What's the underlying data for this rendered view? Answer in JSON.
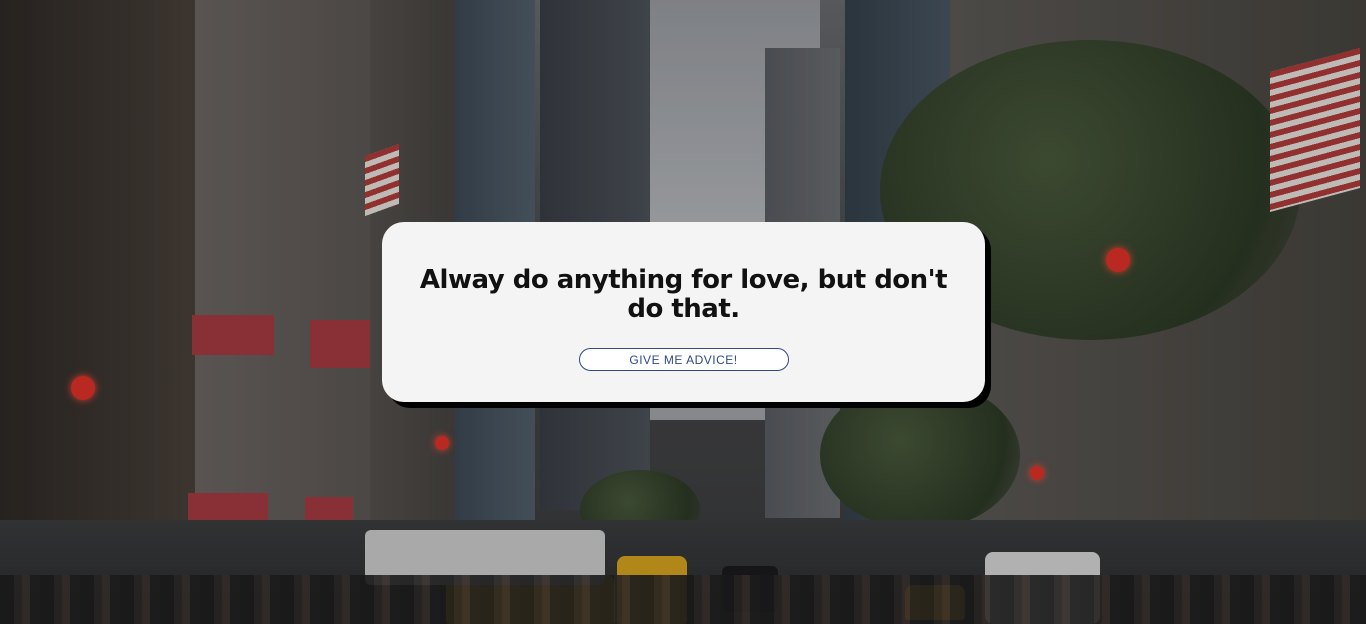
{
  "background": {
    "scene": "city-street-photo"
  },
  "card": {
    "quote": "Alway do anything for love, but don't do that.",
    "button_label": "GIVE ME ADVICE!"
  },
  "colors": {
    "card_background": "#f4f4f4",
    "card_shadow": "#000000",
    "button_text": "#2e4a8a",
    "button_border": "#2e4a8a"
  }
}
